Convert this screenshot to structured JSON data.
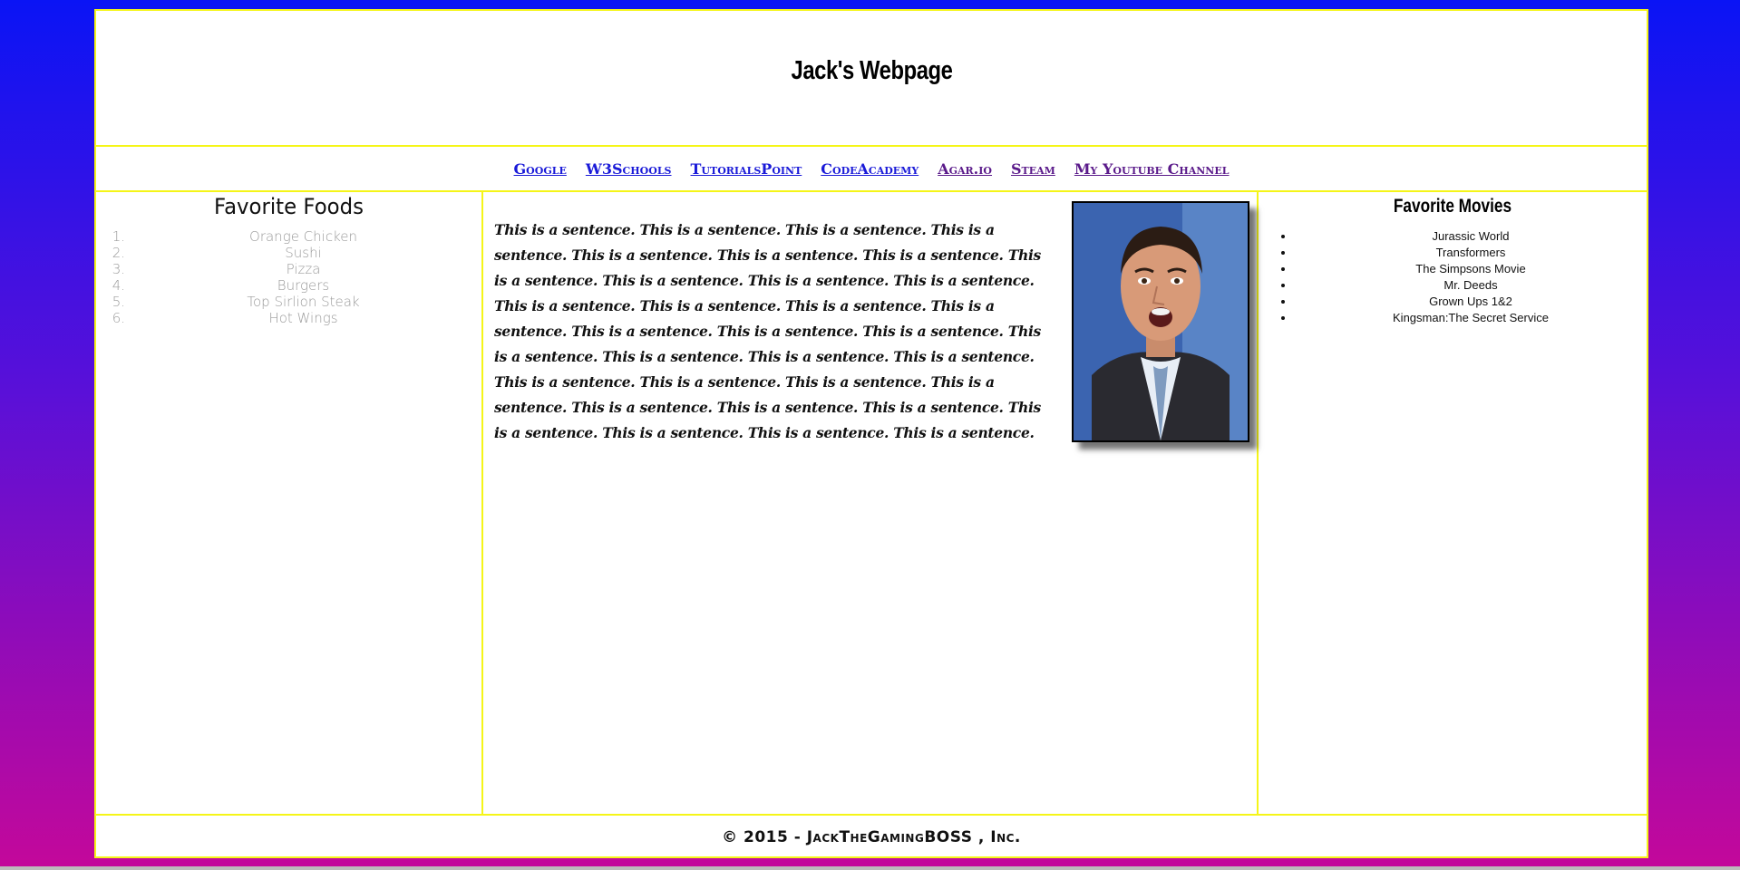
{
  "header": {
    "title": "Jack's Webpage"
  },
  "nav": {
    "links": [
      {
        "label": "Google",
        "visited": false
      },
      {
        "label": "W3Schools",
        "visited": false
      },
      {
        "label": "TutorialsPoint",
        "visited": false
      },
      {
        "label": "CodeAcademy",
        "visited": false
      },
      {
        "label": "Agar.io",
        "visited": true
      },
      {
        "label": "Steam",
        "visited": true
      },
      {
        "label": "My Youtube Channel",
        "visited": true
      }
    ]
  },
  "left": {
    "title": "Favorite Foods",
    "items": [
      {
        "num": "1.",
        "label": "Orange Chicken"
      },
      {
        "num": "2.",
        "label": "Sushi"
      },
      {
        "num": "3.",
        "label": "Pizza"
      },
      {
        "num": "4.",
        "label": "Burgers"
      },
      {
        "num": "5.",
        "label": "Top Sirlion Steak"
      },
      {
        "num": "6.",
        "label": "Hot Wings"
      }
    ]
  },
  "main": {
    "paragraph": "This is a sentence. This is a sentence. This is a sentence. This is a sentence. This is a sentence. This is a sentence. This is a sentence. This is a sentence. This is a sentence. This is a sentence. This is a sentence. This is a sentence. This is a sentence. This is a sentence. This is a sentence. This is a sentence. This is a sentence. This is a sentence. This is a sentence. This is a sentence. This is a sentence. This is a sentence. This is a sentence. This is a sentence. This is a sentence. This is a sentence. This is a sentence. This is a sentence. This is a sentence. This is a sentence. This is a sentence. This is a sentence. This is a sentence."
  },
  "right": {
    "title": "Favorite Movies",
    "items": [
      "Jurassic World",
      "Transformers",
      "The Simpsons Movie",
      "Mr. Deeds",
      "Grown Ups 1&2",
      "Kingsman:The Secret Service"
    ]
  },
  "footer": {
    "text": "© 2015 - JackTheGamingBOSS , Inc."
  },
  "colors": {
    "border": "#f5f518",
    "link": "#1a1ad8",
    "visited": "#5a1a8a",
    "bg_top": "#0a14f5",
    "bg_bottom": "#c4089a"
  }
}
